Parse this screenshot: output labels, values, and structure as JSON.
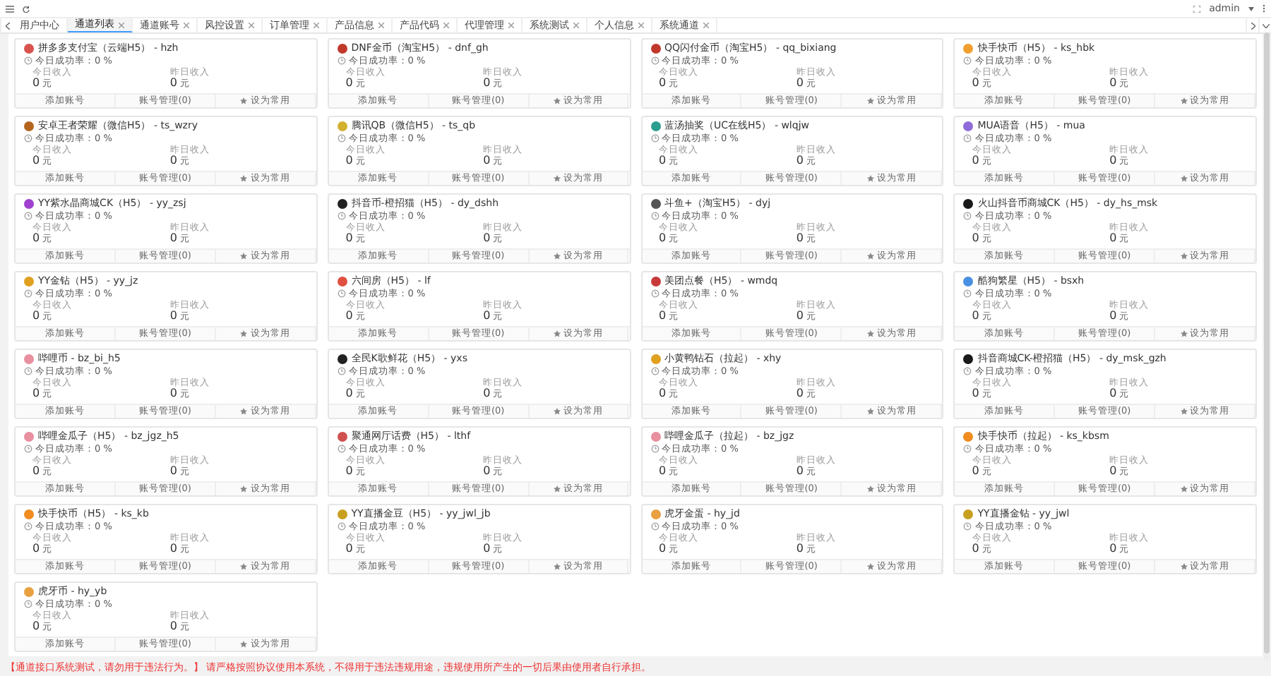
{
  "topbar": {
    "user": "admin"
  },
  "tabs": [
    {
      "label": "用户中心",
      "selected": false,
      "closable": false
    },
    {
      "label": "通道列表",
      "selected": true,
      "closable": true
    },
    {
      "label": "通道账号",
      "selected": false,
      "closable": true
    },
    {
      "label": "风控设置",
      "selected": false,
      "closable": true
    },
    {
      "label": "订单管理",
      "selected": false,
      "closable": true
    },
    {
      "label": "产品信息",
      "selected": false,
      "closable": true
    },
    {
      "label": "产品代码",
      "selected": false,
      "closable": true
    },
    {
      "label": "代理管理",
      "selected": false,
      "closable": true
    },
    {
      "label": "系统测试",
      "selected": false,
      "closable": true
    },
    {
      "label": "个人信息",
      "selected": false,
      "closable": true
    },
    {
      "label": "系统通道",
      "selected": false,
      "closable": true
    }
  ],
  "cards": [
    {
      "title": "拼多多支付宝（云端H5） - hzh",
      "color": "#d9534f",
      "rate": "今日成功率：0 %",
      "stats": [
        {
          "label": "今日收入",
          "value": "0",
          "unit": "元"
        },
        {
          "label": "昨日收入",
          "value": "0",
          "unit": "元"
        }
      ],
      "actions": [
        "添加账号",
        "账号管理(0)",
        "设为常用"
      ]
    },
    {
      "title": "DNF金币（淘宝H5） - dnf_gh",
      "color": "#c0392b",
      "rate": "今日成功率：0 %",
      "stats": [
        {
          "label": "今日收入",
          "value": "0",
          "unit": "元"
        },
        {
          "label": "昨日收入",
          "value": "0",
          "unit": "元"
        }
      ],
      "actions": [
        "添加账号",
        "账号管理(0)",
        "设为常用"
      ]
    },
    {
      "title": "QQ闪付金币（淘宝H5） - qq_bixiang",
      "color": "#c0392b",
      "rate": "今日成功率：0 %",
      "stats": [
        {
          "label": "今日收入",
          "value": "0",
          "unit": "元"
        },
        {
          "label": "昨日收入",
          "value": "0",
          "unit": "元"
        }
      ],
      "actions": [
        "添加账号",
        "账号管理(0)",
        "设为常用"
      ]
    },
    {
      "title": "快手快币（H5） - ks_hbk",
      "color": "#f0a030",
      "rate": "今日成功率：0 %",
      "stats": [
        {
          "label": "今日收入",
          "value": "0",
          "unit": "元"
        },
        {
          "label": "昨日收入",
          "value": "0",
          "unit": "元"
        }
      ],
      "actions": [
        "添加账号",
        "账号管理(0)",
        "设为常用"
      ]
    },
    {
      "title": "安卓王者荣耀（微信H5） - ts_wzry",
      "color": "#b5651d",
      "rate": "今日成功率：0 %",
      "stats": [
        {
          "label": "今日收入",
          "value": "0",
          "unit": "元"
        },
        {
          "label": "昨日收入",
          "value": "0",
          "unit": "元"
        }
      ],
      "actions": [
        "添加账号",
        "账号管理(0)",
        "设为常用"
      ]
    },
    {
      "title": "腾讯QB（微信H5） - ts_qb",
      "color": "#d4b030",
      "rate": "今日成功率：0 %",
      "stats": [
        {
          "label": "今日收入",
          "value": "0",
          "unit": "元"
        },
        {
          "label": "昨日收入",
          "value": "0",
          "unit": "元"
        }
      ],
      "actions": [
        "添加账号",
        "账号管理(0)",
        "设为常用"
      ]
    },
    {
      "title": "蓝汤抽奖（UC在线H5） - wlqjw",
      "color": "#2a9d8f",
      "rate": "今日成功率：0 %",
      "stats": [
        {
          "label": "今日收入",
          "value": "0",
          "unit": "元"
        },
        {
          "label": "昨日收入",
          "value": "0",
          "unit": "元"
        }
      ],
      "actions": [
        "添加账号",
        "账号管理(0)",
        "设为常用"
      ]
    },
    {
      "title": "MUA语音（H5） - mua",
      "color": "#8e6bd8",
      "rate": "今日成功率：0 %",
      "stats": [
        {
          "label": "今日收入",
          "value": "0",
          "unit": "元"
        },
        {
          "label": "昨日收入",
          "value": "0",
          "unit": "元"
        }
      ],
      "actions": [
        "添加账号",
        "账号管理(0)",
        "设为常用"
      ]
    },
    {
      "title": "YY紫水晶商城CK（H5） - yy_zsj",
      "color": "#a040d0",
      "rate": "今日成功率：0 %",
      "stats": [
        {
          "label": "今日收入",
          "value": "0",
          "unit": "元"
        },
        {
          "label": "昨日收入",
          "value": "0",
          "unit": "元"
        }
      ],
      "actions": [
        "添加账号",
        "账号管理(0)",
        "设为常用"
      ]
    },
    {
      "title": "抖音币-橙招猫（H5） - dy_dshh",
      "color": "#222222",
      "rate": "今日成功率：0 %",
      "stats": [
        {
          "label": "今日收入",
          "value": "0",
          "unit": "元"
        },
        {
          "label": "昨日收入",
          "value": "0",
          "unit": "元"
        }
      ],
      "actions": [
        "添加账号",
        "账号管理(0)",
        "设为常用"
      ]
    },
    {
      "title": "斗鱼+（淘宝H5） - dyj",
      "color": "#555555",
      "rate": "今日成功率：0 %",
      "stats": [
        {
          "label": "今日收入",
          "value": "0",
          "unit": "元"
        },
        {
          "label": "昨日收入",
          "value": "0",
          "unit": "元"
        }
      ],
      "actions": [
        "添加账号",
        "账号管理(0)",
        "设为常用"
      ]
    },
    {
      "title": "火山抖音币商城CK（H5） - dy_hs_msk",
      "color": "#1a1a1a",
      "rate": "今日成功率：0 %",
      "stats": [
        {
          "label": "今日收入",
          "value": "0",
          "unit": "元"
        },
        {
          "label": "昨日收入",
          "value": "0",
          "unit": "元"
        }
      ],
      "actions": [
        "添加账号",
        "账号管理(0)",
        "设为常用"
      ]
    },
    {
      "title": "YY金钻（H5） - yy_jz",
      "color": "#e0a020",
      "rate": "今日成功率：0 %",
      "stats": [
        {
          "label": "今日收入",
          "value": "0",
          "unit": "元"
        },
        {
          "label": "昨日收入",
          "value": "0",
          "unit": "元"
        }
      ],
      "actions": [
        "添加账号",
        "账号管理(0)",
        "设为常用"
      ]
    },
    {
      "title": "六间房（H5） - lf",
      "color": "#e05040",
      "rate": "今日成功率：0 %",
      "stats": [
        {
          "label": "今日收入",
          "value": "0",
          "unit": "元"
        },
        {
          "label": "昨日收入",
          "value": "0",
          "unit": "元"
        }
      ],
      "actions": [
        "添加账号",
        "账号管理(0)",
        "设为常用"
      ]
    },
    {
      "title": "美团点餐（H5） - wmdq",
      "color": "#c83a3a",
      "rate": "今日成功率：0 %",
      "stats": [
        {
          "label": "今日收入",
          "value": "0",
          "unit": "元"
        },
        {
          "label": "昨日收入",
          "value": "0",
          "unit": "元"
        }
      ],
      "actions": [
        "添加账号",
        "账号管理(0)",
        "设为常用"
      ]
    },
    {
      "title": "酷狗繁星（H5） - bsxh",
      "color": "#4a90e2",
      "rate": "今日成功率：0 %",
      "stats": [
        {
          "label": "今日收入",
          "value": "0",
          "unit": "元"
        },
        {
          "label": "昨日收入",
          "value": "0",
          "unit": "元"
        }
      ],
      "actions": [
        "添加账号",
        "账号管理(0)",
        "设为常用"
      ]
    },
    {
      "title": "哔哩币 - bz_bi_h5",
      "color": "#e88fa0",
      "rate": "今日成功率：0 %",
      "stats": [
        {
          "label": "今日收入",
          "value": "0",
          "unit": "元"
        },
        {
          "label": "昨日收入",
          "value": "0",
          "unit": "元"
        }
      ],
      "actions": [
        "添加账号",
        "账号管理(0)",
        "设为常用"
      ]
    },
    {
      "title": "全民K歌鲜花（H5） - yxs",
      "color": "#222222",
      "rate": "今日成功率：0 %",
      "stats": [
        {
          "label": "今日收入",
          "value": "0",
          "unit": "元"
        },
        {
          "label": "昨日收入",
          "value": "0",
          "unit": "元"
        }
      ],
      "actions": [
        "添加账号",
        "账号管理(0)",
        "设为常用"
      ]
    },
    {
      "title": "小黄鸭钻石（拉起） - xhy",
      "color": "#e0a020",
      "rate": "今日成功率：0 %",
      "stats": [
        {
          "label": "今日收入",
          "value": "0",
          "unit": "元"
        },
        {
          "label": "昨日收入",
          "value": "0",
          "unit": "元"
        }
      ],
      "actions": [
        "添加账号",
        "账号管理(0)",
        "设为常用"
      ]
    },
    {
      "title": "抖音商城CK-橙招猫（H5） - dy_msk_gzh",
      "color": "#1a1a1a",
      "rate": "今日成功率：0 %",
      "stats": [
        {
          "label": "今日收入",
          "value": "0",
          "unit": "元"
        },
        {
          "label": "昨日收入",
          "value": "0",
          "unit": "元"
        }
      ],
      "actions": [
        "添加账号",
        "账号管理(0)",
        "设为常用"
      ]
    },
    {
      "title": "哔哩金瓜子（H5） - bz_jgz_h5",
      "color": "#e88fa0",
      "rate": "今日成功率：0 %",
      "stats": [
        {
          "label": "今日收入",
          "value": "0",
          "unit": "元"
        },
        {
          "label": "昨日收入",
          "value": "0",
          "unit": "元"
        }
      ],
      "actions": [
        "添加账号",
        "账号管理(0)",
        "设为常用"
      ]
    },
    {
      "title": "聚通网厅话费（H5） - lthf",
      "color": "#d05050",
      "rate": "今日成功率：0 %",
      "stats": [
        {
          "label": "今日收入",
          "value": "0",
          "unit": "元"
        },
        {
          "label": "昨日收入",
          "value": "0",
          "unit": "元"
        }
      ],
      "actions": [
        "添加账号",
        "账号管理(0)",
        "设为常用"
      ]
    },
    {
      "title": "哔哩金瓜子（拉起） - bz_jgz",
      "color": "#e88fa0",
      "rate": "今日成功率：0 %",
      "stats": [
        {
          "label": "今日收入",
          "value": "0",
          "unit": "元"
        },
        {
          "label": "昨日收入",
          "value": "0",
          "unit": "元"
        }
      ],
      "actions": [
        "添加账号",
        "账号管理(0)",
        "设为常用"
      ]
    },
    {
      "title": "快手快币（拉起） - ks_kbsm",
      "color": "#f08c20",
      "rate": "今日成功率：0 %",
      "stats": [
        {
          "label": "今日收入",
          "value": "0",
          "unit": "元"
        },
        {
          "label": "昨日收入",
          "value": "0",
          "unit": "元"
        }
      ],
      "actions": [
        "添加账号",
        "账号管理(0)",
        "设为常用"
      ]
    },
    {
      "title": "快手快币（H5） - ks_kb",
      "color": "#f08c20",
      "rate": "今日成功率：0 %",
      "stats": [
        {
          "label": "今日收入",
          "value": "0",
          "unit": "元"
        },
        {
          "label": "昨日收入",
          "value": "0",
          "unit": "元"
        }
      ],
      "actions": [
        "添加账号",
        "账号管理(0)",
        "设为常用"
      ]
    },
    {
      "title": "YY直播金豆（H5） - yy_jwl_jb",
      "color": "#c8a020",
      "rate": "今日成功率：0 %",
      "stats": [
        {
          "label": "今日收入",
          "value": "0",
          "unit": "元"
        },
        {
          "label": "昨日收入",
          "value": "0",
          "unit": "元"
        }
      ],
      "actions": [
        "添加账号",
        "账号管理(0)",
        "设为常用"
      ]
    },
    {
      "title": "虎牙金蛋 - hy_jd",
      "color": "#e8a040",
      "rate": "今日成功率：0 %",
      "stats": [
        {
          "label": "今日收入",
          "value": "0",
          "unit": "元"
        },
        {
          "label": "昨日收入",
          "value": "0",
          "unit": "元"
        }
      ],
      "actions": [
        "添加账号",
        "账号管理(0)",
        "设为常用"
      ]
    },
    {
      "title": "YY直播金钻 - yy_jwl",
      "color": "#c8a020",
      "rate": "今日成功率：0 %",
      "stats": [
        {
          "label": "今日收入",
          "value": "0",
          "unit": "元"
        },
        {
          "label": "昨日收入",
          "value": "0",
          "unit": "元"
        }
      ],
      "actions": [
        "添加账号",
        "账号管理(0)",
        "设为常用"
      ]
    },
    {
      "title": "虎牙币 - hy_yb",
      "color": "#e8a040",
      "rate": "今日成功率：0 %",
      "stats": [
        {
          "label": "今日收入",
          "value": "0",
          "unit": "元"
        },
        {
          "label": "昨日收入",
          "value": "0",
          "unit": "元"
        }
      ],
      "actions": [
        "添加账号",
        "账号管理(0)",
        "设为常用"
      ]
    }
  ],
  "notice": "【通道接口系统测试，请勿用于违法行为。】 请严格按照协议使用本系统，不得用于违法违规用途，违规使用所产生的一切后果由使用者自行承担。"
}
